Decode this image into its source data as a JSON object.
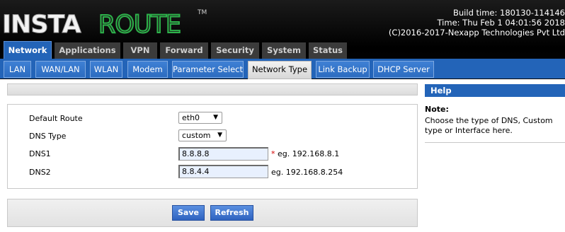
{
  "brand": {
    "part1": "INSTA",
    "part2": "ROUTE",
    "tm": "TM"
  },
  "build": {
    "line1": "Build time: 180130-114146",
    "line2": "Time: Thu Feb 1 04:01:56 2018",
    "line3": "(C)2016-2017-Nexapp Technologies Pvt Ltd"
  },
  "main_tabs": [
    "Network",
    "Applications",
    "VPN",
    "Forward",
    "Security",
    "System",
    "Status"
  ],
  "active_main_tab": "Network",
  "sub_tabs": [
    "LAN",
    "WAN/LAN",
    "WLAN",
    "Modem",
    "Parameter Select",
    "Network Type",
    "Link Backup",
    "DHCP Server"
  ],
  "active_sub_tab": "Network Type",
  "form": {
    "default_route": {
      "label": "Default Route",
      "value": "eth0"
    },
    "dns_type": {
      "label": "DNS Type",
      "value": "custom"
    },
    "dns1": {
      "label": "DNS1",
      "value": "8.8.8.8",
      "required": "*",
      "hint": "eg. 192.168.8.1"
    },
    "dns2": {
      "label": "DNS2",
      "value": "8.8.4.4",
      "hint": "eg. 192.168.8.254"
    }
  },
  "buttons": {
    "save": "Save",
    "refresh": "Refresh"
  },
  "help": {
    "title": "Help",
    "note_label": "Note:",
    "text": "Choose the type of DNS, Custom type or Interface here."
  },
  "colors": {
    "accent_blue": "#2364b8",
    "logo_green": "#2db24a",
    "required_red": "#d40000"
  }
}
